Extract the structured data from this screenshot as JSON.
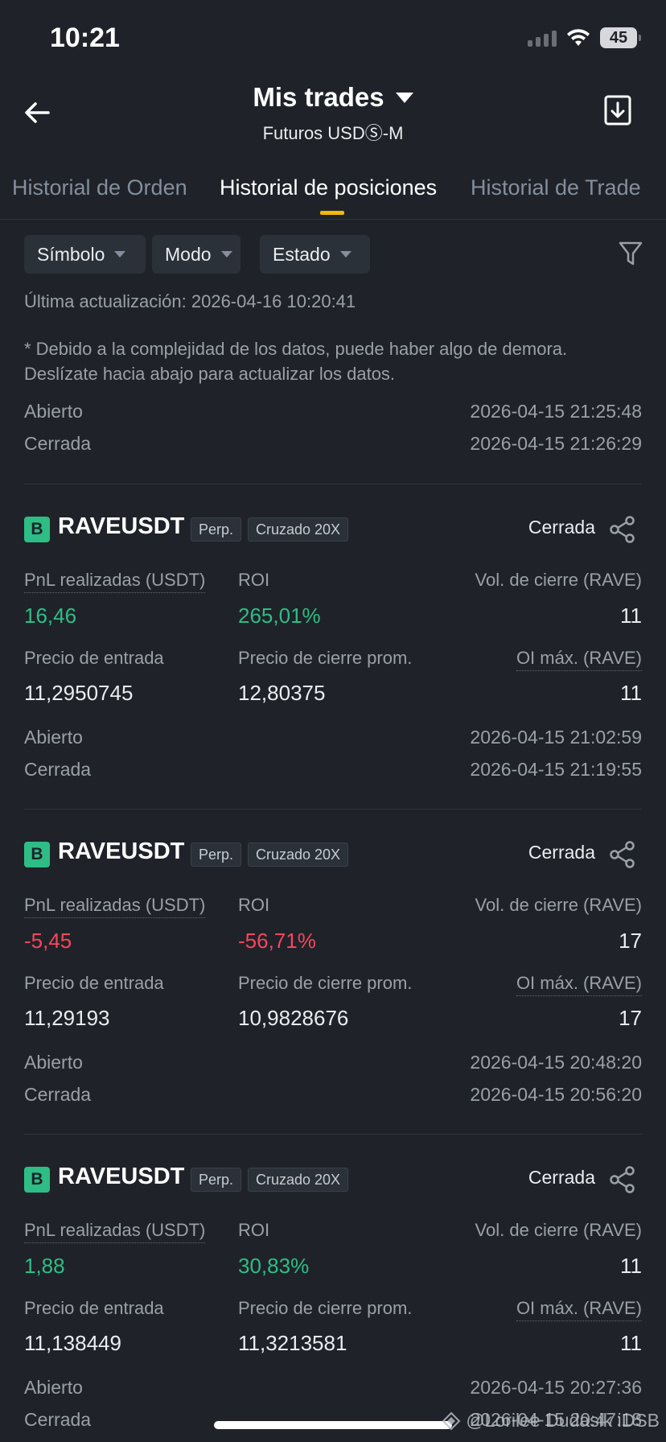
{
  "status_bar": {
    "time": "10:21",
    "battery": "45"
  },
  "header": {
    "title": "Mis trades",
    "subtitle": "Futuros USDⓈ-M"
  },
  "tabs": [
    {
      "label": "Historial de Orden"
    },
    {
      "label": "Historial de posiciones"
    },
    {
      "label": "Historial de Trade"
    }
  ],
  "filters": [
    {
      "label": "Símbolo"
    },
    {
      "label": "Modo"
    },
    {
      "label": "Estado"
    }
  ],
  "last_update": "Última actualización: 2026-04-16 10:20:41",
  "notice": "* Debido a la complejidad de los datos, puede haber algo de demora. Deslízate hacia abajo para actualizar los datos.",
  "top_times": {
    "opened_label": "Abierto",
    "opened": "2026-04-15 21:25:48",
    "closed_label": "Cerrada",
    "closed": "2026-04-15 21:26:29"
  },
  "labels": {
    "pnl": "PnL realizadas (USDT)",
    "roi": "ROI",
    "close_vol": "Vol. de cierre (RAVE)",
    "entry": "Precio de entrada",
    "close_avg": "Precio de cierre prom.",
    "oi_max": "OI máx. (RAVE)",
    "opened": "Abierto",
    "closed": "Cerrada"
  },
  "positions": [
    {
      "side": "B",
      "symbol": "RAVEUSDT",
      "type": "Perp.",
      "margin": "Cruzado 20X",
      "status": "Cerrada",
      "pnl": "16,46",
      "roi": "265,01%",
      "close_vol": "11",
      "entry": "11,2950745",
      "close_avg": "12,80375",
      "oi_max": "11",
      "opened": "2026-04-15 21:02:59",
      "closed": "2026-04-15 21:19:55"
    },
    {
      "side": "B",
      "symbol": "RAVEUSDT",
      "type": "Perp.",
      "margin": "Cruzado 20X",
      "status": "Cerrada",
      "pnl": "-5,45",
      "roi": "-56,71%",
      "close_vol": "17",
      "entry": "11,29193",
      "close_avg": "10,9828676",
      "oi_max": "17",
      "opened": "2026-04-15 20:48:20",
      "closed": "2026-04-15 20:56:20"
    },
    {
      "side": "B",
      "symbol": "RAVEUSDT",
      "type": "Perp.",
      "margin": "Cruzado 20X",
      "status": "Cerrada",
      "pnl": "1,88",
      "roi": "30,83%",
      "close_vol": "11",
      "entry": "11,138449",
      "close_avg": "11,3213581",
      "oi_max": "11",
      "opened": "2026-04-15 20:27:36",
      "closed": "2026-04-15 20:47:18"
    }
  ],
  "watermark": "@Lorilee Dudasik iDSB",
  "colors": {
    "positive": "#2ebd85",
    "negative": "#f6465d",
    "accent": "#f0b90b",
    "background": "#1f2329"
  }
}
